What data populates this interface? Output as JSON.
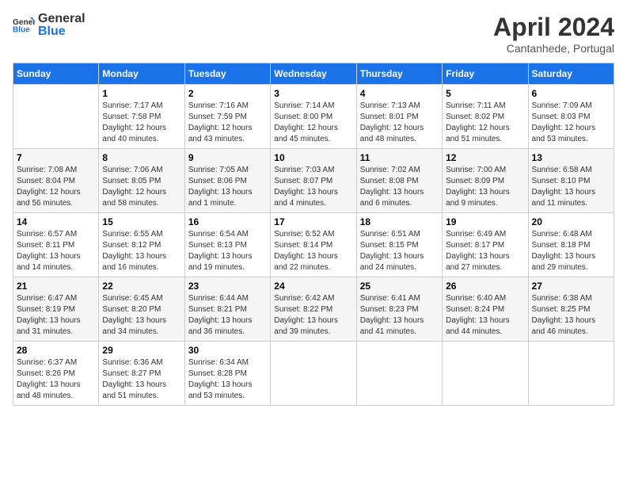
{
  "header": {
    "logo_general": "General",
    "logo_blue": "Blue",
    "month_title": "April 2024",
    "location": "Cantanhede, Portugal"
  },
  "days_of_week": [
    "Sunday",
    "Monday",
    "Tuesday",
    "Wednesday",
    "Thursday",
    "Friday",
    "Saturday"
  ],
  "weeks": [
    [
      {
        "day": "",
        "sunrise": "",
        "sunset": "",
        "daylight": ""
      },
      {
        "day": "1",
        "sunrise": "Sunrise: 7:17 AM",
        "sunset": "Sunset: 7:58 PM",
        "daylight": "Daylight: 12 hours and 40 minutes."
      },
      {
        "day": "2",
        "sunrise": "Sunrise: 7:16 AM",
        "sunset": "Sunset: 7:59 PM",
        "daylight": "Daylight: 12 hours and 43 minutes."
      },
      {
        "day": "3",
        "sunrise": "Sunrise: 7:14 AM",
        "sunset": "Sunset: 8:00 PM",
        "daylight": "Daylight: 12 hours and 45 minutes."
      },
      {
        "day": "4",
        "sunrise": "Sunrise: 7:13 AM",
        "sunset": "Sunset: 8:01 PM",
        "daylight": "Daylight: 12 hours and 48 minutes."
      },
      {
        "day": "5",
        "sunrise": "Sunrise: 7:11 AM",
        "sunset": "Sunset: 8:02 PM",
        "daylight": "Daylight: 12 hours and 51 minutes."
      },
      {
        "day": "6",
        "sunrise": "Sunrise: 7:09 AM",
        "sunset": "Sunset: 8:03 PM",
        "daylight": "Daylight: 12 hours and 53 minutes."
      }
    ],
    [
      {
        "day": "7",
        "sunrise": "Sunrise: 7:08 AM",
        "sunset": "Sunset: 8:04 PM",
        "daylight": "Daylight: 12 hours and 56 minutes."
      },
      {
        "day": "8",
        "sunrise": "Sunrise: 7:06 AM",
        "sunset": "Sunset: 8:05 PM",
        "daylight": "Daylight: 12 hours and 58 minutes."
      },
      {
        "day": "9",
        "sunrise": "Sunrise: 7:05 AM",
        "sunset": "Sunset: 8:06 PM",
        "daylight": "Daylight: 13 hours and 1 minute."
      },
      {
        "day": "10",
        "sunrise": "Sunrise: 7:03 AM",
        "sunset": "Sunset: 8:07 PM",
        "daylight": "Daylight: 13 hours and 4 minutes."
      },
      {
        "day": "11",
        "sunrise": "Sunrise: 7:02 AM",
        "sunset": "Sunset: 8:08 PM",
        "daylight": "Daylight: 13 hours and 6 minutes."
      },
      {
        "day": "12",
        "sunrise": "Sunrise: 7:00 AM",
        "sunset": "Sunset: 8:09 PM",
        "daylight": "Daylight: 13 hours and 9 minutes."
      },
      {
        "day": "13",
        "sunrise": "Sunrise: 6:58 AM",
        "sunset": "Sunset: 8:10 PM",
        "daylight": "Daylight: 13 hours and 11 minutes."
      }
    ],
    [
      {
        "day": "14",
        "sunrise": "Sunrise: 6:57 AM",
        "sunset": "Sunset: 8:11 PM",
        "daylight": "Daylight: 13 hours and 14 minutes."
      },
      {
        "day": "15",
        "sunrise": "Sunrise: 6:55 AM",
        "sunset": "Sunset: 8:12 PM",
        "daylight": "Daylight: 13 hours and 16 minutes."
      },
      {
        "day": "16",
        "sunrise": "Sunrise: 6:54 AM",
        "sunset": "Sunset: 8:13 PM",
        "daylight": "Daylight: 13 hours and 19 minutes."
      },
      {
        "day": "17",
        "sunrise": "Sunrise: 6:52 AM",
        "sunset": "Sunset: 8:14 PM",
        "daylight": "Daylight: 13 hours and 22 minutes."
      },
      {
        "day": "18",
        "sunrise": "Sunrise: 6:51 AM",
        "sunset": "Sunset: 8:15 PM",
        "daylight": "Daylight: 13 hours and 24 minutes."
      },
      {
        "day": "19",
        "sunrise": "Sunrise: 6:49 AM",
        "sunset": "Sunset: 8:17 PM",
        "daylight": "Daylight: 13 hours and 27 minutes."
      },
      {
        "day": "20",
        "sunrise": "Sunrise: 6:48 AM",
        "sunset": "Sunset: 8:18 PM",
        "daylight": "Daylight: 13 hours and 29 minutes."
      }
    ],
    [
      {
        "day": "21",
        "sunrise": "Sunrise: 6:47 AM",
        "sunset": "Sunset: 8:19 PM",
        "daylight": "Daylight: 13 hours and 31 minutes."
      },
      {
        "day": "22",
        "sunrise": "Sunrise: 6:45 AM",
        "sunset": "Sunset: 8:20 PM",
        "daylight": "Daylight: 13 hours and 34 minutes."
      },
      {
        "day": "23",
        "sunrise": "Sunrise: 6:44 AM",
        "sunset": "Sunset: 8:21 PM",
        "daylight": "Daylight: 13 hours and 36 minutes."
      },
      {
        "day": "24",
        "sunrise": "Sunrise: 6:42 AM",
        "sunset": "Sunset: 8:22 PM",
        "daylight": "Daylight: 13 hours and 39 minutes."
      },
      {
        "day": "25",
        "sunrise": "Sunrise: 6:41 AM",
        "sunset": "Sunset: 8:23 PM",
        "daylight": "Daylight: 13 hours and 41 minutes."
      },
      {
        "day": "26",
        "sunrise": "Sunrise: 6:40 AM",
        "sunset": "Sunset: 8:24 PM",
        "daylight": "Daylight: 13 hours and 44 minutes."
      },
      {
        "day": "27",
        "sunrise": "Sunrise: 6:38 AM",
        "sunset": "Sunset: 8:25 PM",
        "daylight": "Daylight: 13 hours and 46 minutes."
      }
    ],
    [
      {
        "day": "28",
        "sunrise": "Sunrise: 6:37 AM",
        "sunset": "Sunset: 8:26 PM",
        "daylight": "Daylight: 13 hours and 48 minutes."
      },
      {
        "day": "29",
        "sunrise": "Sunrise: 6:36 AM",
        "sunset": "Sunset: 8:27 PM",
        "daylight": "Daylight: 13 hours and 51 minutes."
      },
      {
        "day": "30",
        "sunrise": "Sunrise: 6:34 AM",
        "sunset": "Sunset: 8:28 PM",
        "daylight": "Daylight: 13 hours and 53 minutes."
      },
      {
        "day": "",
        "sunrise": "",
        "sunset": "",
        "daylight": ""
      },
      {
        "day": "",
        "sunrise": "",
        "sunset": "",
        "daylight": ""
      },
      {
        "day": "",
        "sunrise": "",
        "sunset": "",
        "daylight": ""
      },
      {
        "day": "",
        "sunrise": "",
        "sunset": "",
        "daylight": ""
      }
    ]
  ]
}
